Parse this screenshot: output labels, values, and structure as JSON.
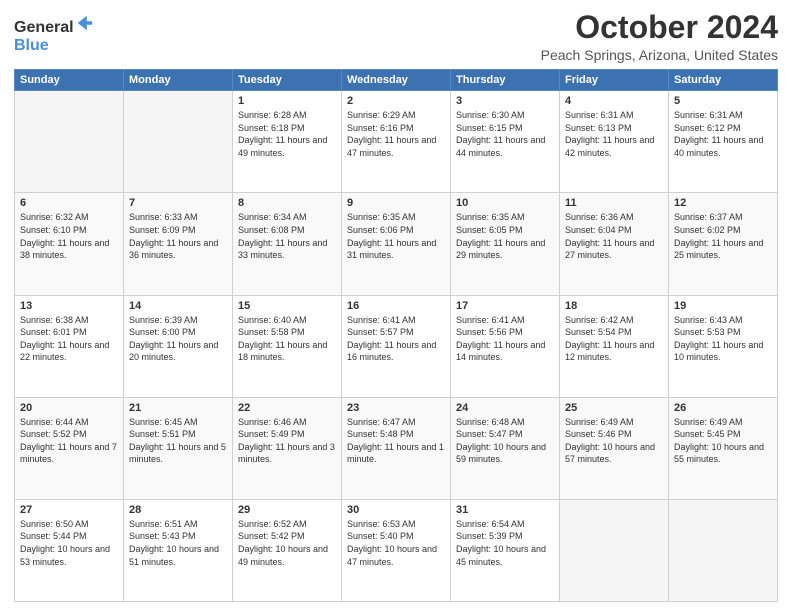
{
  "header": {
    "logo_general": "General",
    "logo_blue": "Blue",
    "title": "October 2024",
    "subtitle": "Peach Springs, Arizona, United States"
  },
  "weekdays": [
    "Sunday",
    "Monday",
    "Tuesday",
    "Wednesday",
    "Thursday",
    "Friday",
    "Saturday"
  ],
  "weeks": [
    [
      {
        "day": "",
        "info": ""
      },
      {
        "day": "",
        "info": ""
      },
      {
        "day": "1",
        "info": "Sunrise: 6:28 AM\nSunset: 6:18 PM\nDaylight: 11 hours and 49 minutes."
      },
      {
        "day": "2",
        "info": "Sunrise: 6:29 AM\nSunset: 6:16 PM\nDaylight: 11 hours and 47 minutes."
      },
      {
        "day": "3",
        "info": "Sunrise: 6:30 AM\nSunset: 6:15 PM\nDaylight: 11 hours and 44 minutes."
      },
      {
        "day": "4",
        "info": "Sunrise: 6:31 AM\nSunset: 6:13 PM\nDaylight: 11 hours and 42 minutes."
      },
      {
        "day": "5",
        "info": "Sunrise: 6:31 AM\nSunset: 6:12 PM\nDaylight: 11 hours and 40 minutes."
      }
    ],
    [
      {
        "day": "6",
        "info": "Sunrise: 6:32 AM\nSunset: 6:10 PM\nDaylight: 11 hours and 38 minutes."
      },
      {
        "day": "7",
        "info": "Sunrise: 6:33 AM\nSunset: 6:09 PM\nDaylight: 11 hours and 36 minutes."
      },
      {
        "day": "8",
        "info": "Sunrise: 6:34 AM\nSunset: 6:08 PM\nDaylight: 11 hours and 33 minutes."
      },
      {
        "day": "9",
        "info": "Sunrise: 6:35 AM\nSunset: 6:06 PM\nDaylight: 11 hours and 31 minutes."
      },
      {
        "day": "10",
        "info": "Sunrise: 6:35 AM\nSunset: 6:05 PM\nDaylight: 11 hours and 29 minutes."
      },
      {
        "day": "11",
        "info": "Sunrise: 6:36 AM\nSunset: 6:04 PM\nDaylight: 11 hours and 27 minutes."
      },
      {
        "day": "12",
        "info": "Sunrise: 6:37 AM\nSunset: 6:02 PM\nDaylight: 11 hours and 25 minutes."
      }
    ],
    [
      {
        "day": "13",
        "info": "Sunrise: 6:38 AM\nSunset: 6:01 PM\nDaylight: 11 hours and 22 minutes."
      },
      {
        "day": "14",
        "info": "Sunrise: 6:39 AM\nSunset: 6:00 PM\nDaylight: 11 hours and 20 minutes."
      },
      {
        "day": "15",
        "info": "Sunrise: 6:40 AM\nSunset: 5:58 PM\nDaylight: 11 hours and 18 minutes."
      },
      {
        "day": "16",
        "info": "Sunrise: 6:41 AM\nSunset: 5:57 PM\nDaylight: 11 hours and 16 minutes."
      },
      {
        "day": "17",
        "info": "Sunrise: 6:41 AM\nSunset: 5:56 PM\nDaylight: 11 hours and 14 minutes."
      },
      {
        "day": "18",
        "info": "Sunrise: 6:42 AM\nSunset: 5:54 PM\nDaylight: 11 hours and 12 minutes."
      },
      {
        "day": "19",
        "info": "Sunrise: 6:43 AM\nSunset: 5:53 PM\nDaylight: 11 hours and 10 minutes."
      }
    ],
    [
      {
        "day": "20",
        "info": "Sunrise: 6:44 AM\nSunset: 5:52 PM\nDaylight: 11 hours and 7 minutes."
      },
      {
        "day": "21",
        "info": "Sunrise: 6:45 AM\nSunset: 5:51 PM\nDaylight: 11 hours and 5 minutes."
      },
      {
        "day": "22",
        "info": "Sunrise: 6:46 AM\nSunset: 5:49 PM\nDaylight: 11 hours and 3 minutes."
      },
      {
        "day": "23",
        "info": "Sunrise: 6:47 AM\nSunset: 5:48 PM\nDaylight: 11 hours and 1 minute."
      },
      {
        "day": "24",
        "info": "Sunrise: 6:48 AM\nSunset: 5:47 PM\nDaylight: 10 hours and 59 minutes."
      },
      {
        "day": "25",
        "info": "Sunrise: 6:49 AM\nSunset: 5:46 PM\nDaylight: 10 hours and 57 minutes."
      },
      {
        "day": "26",
        "info": "Sunrise: 6:49 AM\nSunset: 5:45 PM\nDaylight: 10 hours and 55 minutes."
      }
    ],
    [
      {
        "day": "27",
        "info": "Sunrise: 6:50 AM\nSunset: 5:44 PM\nDaylight: 10 hours and 53 minutes."
      },
      {
        "day": "28",
        "info": "Sunrise: 6:51 AM\nSunset: 5:43 PM\nDaylight: 10 hours and 51 minutes."
      },
      {
        "day": "29",
        "info": "Sunrise: 6:52 AM\nSunset: 5:42 PM\nDaylight: 10 hours and 49 minutes."
      },
      {
        "day": "30",
        "info": "Sunrise: 6:53 AM\nSunset: 5:40 PM\nDaylight: 10 hours and 47 minutes."
      },
      {
        "day": "31",
        "info": "Sunrise: 6:54 AM\nSunset: 5:39 PM\nDaylight: 10 hours and 45 minutes."
      },
      {
        "day": "",
        "info": ""
      },
      {
        "day": "",
        "info": ""
      }
    ]
  ]
}
